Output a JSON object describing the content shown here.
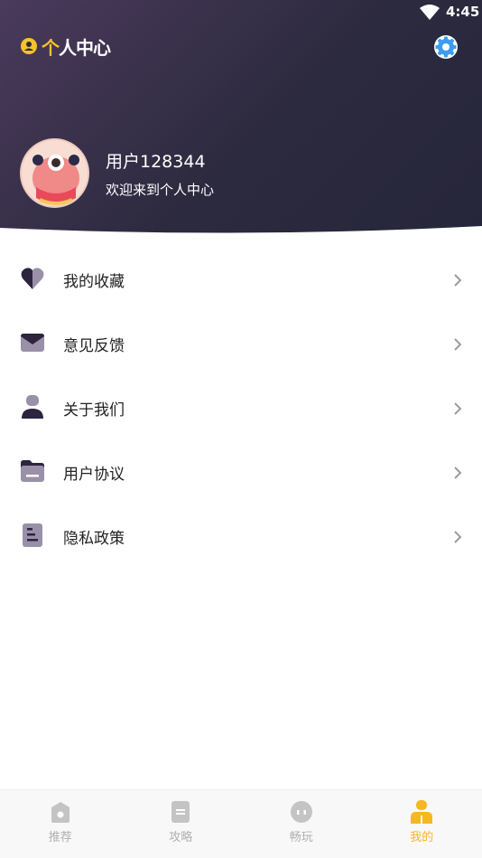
{
  "status_bar": {
    "time": "4:45"
  },
  "header": {
    "title_prefix": "个",
    "title_rest": "人中心",
    "settings_icon": "gear-icon"
  },
  "profile": {
    "username": "用户128344",
    "welcome": "欢迎来到个人中心"
  },
  "menu": {
    "items": [
      {
        "label": "我的收藏",
        "icon": "heart-icon"
      },
      {
        "label": "意见反馈",
        "icon": "mail-icon"
      },
      {
        "label": "关于我们",
        "icon": "person-icon"
      },
      {
        "label": "用户协议",
        "icon": "folder-icon"
      },
      {
        "label": "隐私政策",
        "icon": "document-icon"
      }
    ]
  },
  "bottom_nav": {
    "items": [
      {
        "label": "推荐",
        "icon": "home-icon",
        "active": false
      },
      {
        "label": "攻略",
        "icon": "notes-icon",
        "active": false
      },
      {
        "label": "畅玩",
        "icon": "game-icon",
        "active": false
      },
      {
        "label": "我的",
        "icon": "profile-icon",
        "active": true
      }
    ]
  },
  "colors": {
    "accent": "#f5b820",
    "header_dark": "#2c2a3e",
    "icon_dark": "#2d2440",
    "icon_light": "#9a90a8",
    "settings_blue": "#3d9cf0"
  }
}
